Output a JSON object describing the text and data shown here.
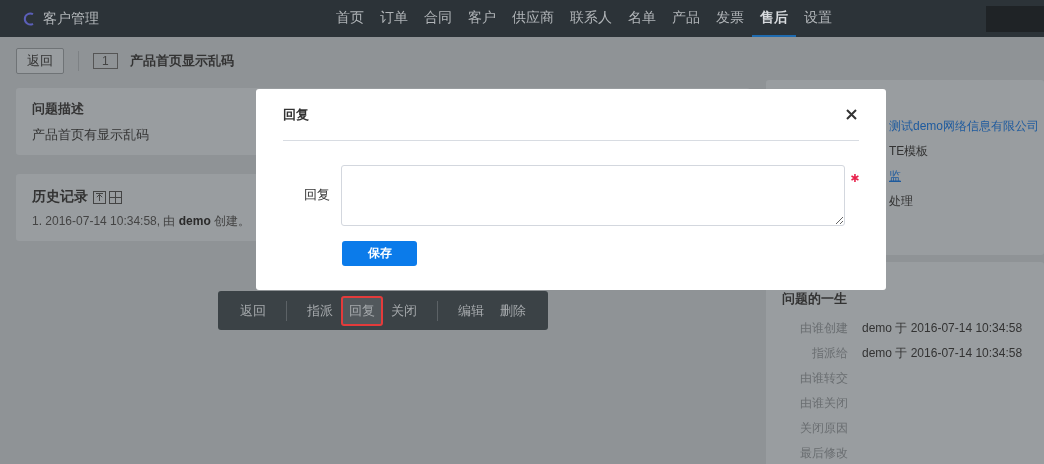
{
  "app": {
    "title": "客户管理"
  },
  "nav": [
    {
      "label": "首页",
      "selected": false
    },
    {
      "label": "订单",
      "selected": false
    },
    {
      "label": "合同",
      "selected": false
    },
    {
      "label": "客户",
      "selected": false
    },
    {
      "label": "供应商",
      "selected": false
    },
    {
      "label": "联系人",
      "selected": false
    },
    {
      "label": "名单",
      "selected": false
    },
    {
      "label": "产品",
      "selected": false
    },
    {
      "label": "发票",
      "selected": false
    },
    {
      "label": "售后",
      "selected": true
    },
    {
      "label": "设置",
      "selected": false
    }
  ],
  "page_header": {
    "back": "返回",
    "id": "1",
    "title": "产品首页显示乱码"
  },
  "description": {
    "title": "问题描述",
    "text": "产品首页有显示乱码"
  },
  "history": {
    "title": "历史记录",
    "entries": [
      "1. 2016-07-14 10:34:58, 由 **demo** 创建。"
    ]
  },
  "toolbar": [
    {
      "buttons": [
        {
          "label": "返回",
          "selected": false
        }
      ]
    },
    {
      "buttons": [
        {
          "label": "指派",
          "selected": false
        },
        {
          "label": "回复",
          "selected": true
        },
        {
          "label": "关闭",
          "selected": false
        }
      ]
    },
    {
      "buttons": [
        {
          "label": "编辑",
          "selected": false
        },
        {
          "label": "删除",
          "selected": false
        }
      ]
    }
  ],
  "basic_info": [
    {
      "value": "测试demo网络信息有限公司",
      "kind": "link"
    },
    {
      "value": "TE模板",
      "kind": "text"
    },
    {
      "value": "监",
      "kind": "link"
    },
    {
      "value": "处理",
      "kind": "text"
    }
  ],
  "lifecycle": {
    "title": "问题的一生",
    "rows": [
      {
        "label": "由谁创建",
        "value": "demo 于 2016-07-14 10:34:58"
      },
      {
        "label": "指派给",
        "value": "demo 于 2016-07-14 10:34:58"
      },
      {
        "label": "由谁转交"
      },
      {
        "label": "由谁关闭"
      },
      {
        "label": "关闭原因"
      },
      {
        "label": "最后修改"
      }
    ]
  },
  "dialog": {
    "title": "回复",
    "field_label": "回复",
    "required": true,
    "save": "保存"
  }
}
